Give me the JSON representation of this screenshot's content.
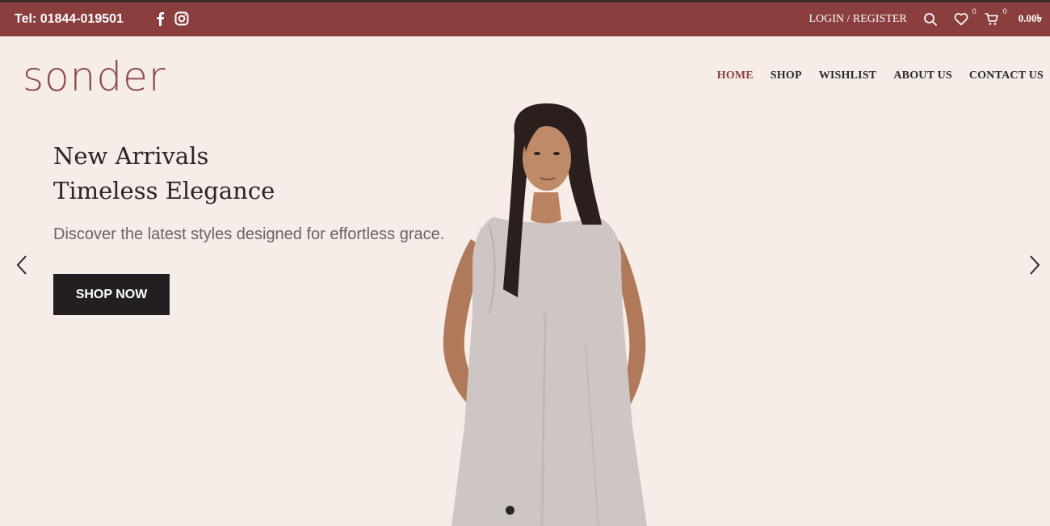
{
  "topbar": {
    "phone": "Tel: 01844-019501",
    "login_label": "LOGIN / REGISTER",
    "wishlist_count": "0",
    "cart_count": "0",
    "cart_total": "0.00৳"
  },
  "header": {
    "logo": "sonder",
    "nav": [
      "HOME",
      "SHOP",
      "WISHLIST",
      "ABOUT US",
      "CONTACT US"
    ],
    "active_nav": "HOME"
  },
  "hero": {
    "title_line1": "New Arrivals",
    "title_line2": "Timeless Elegance",
    "subtitle": "Discover the latest styles designed for effortless grace.",
    "cta_label": "SHOP NOW",
    "slides": 3,
    "active_slide": 1
  },
  "icons": {
    "facebook": "facebook-icon",
    "instagram": "instagram-icon",
    "search": "search-icon",
    "wishlist": "heart-icon",
    "cart": "cart-icon",
    "prev": "chevron-left-icon",
    "next": "chevron-right-icon"
  },
  "colors": {
    "topbar": "#8a3f3e",
    "background": "#f6ece8",
    "button": "#231f20",
    "accent": "#8a3f3e"
  }
}
